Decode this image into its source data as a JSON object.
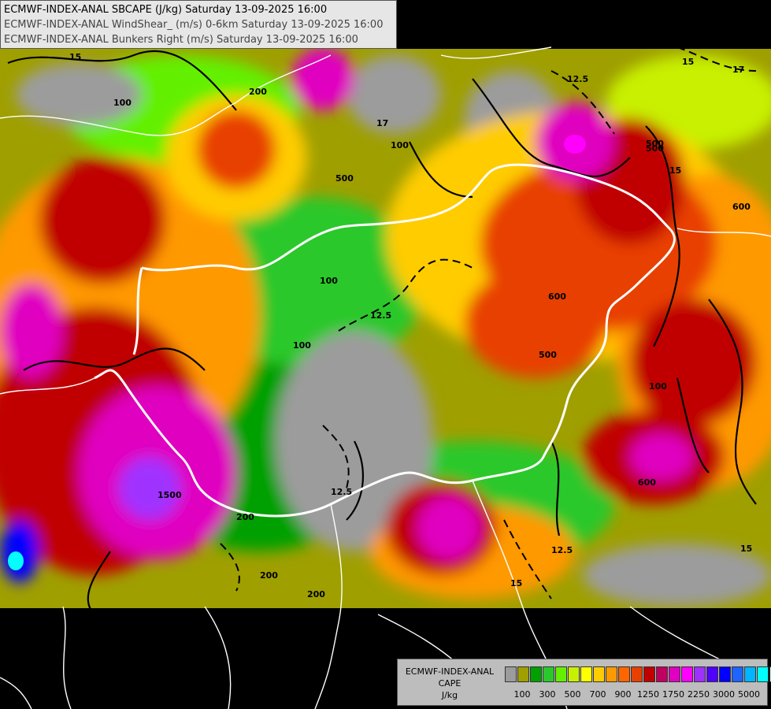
{
  "header": {
    "line1": "ECMWF-INDEX-ANAL SBCAPE (J/kg) Saturday 13-09-2025 16:00",
    "line2": "ECMWF-INDEX-ANAL WindShear_ (m/s) 0-6km Saturday 13-09-2025 16:00",
    "line3": "ECMWF-INDEX-ANAL Bunkers Right (m/s) Saturday 13-09-2025 16:00"
  },
  "legend": {
    "title_line1": "ECMWF-INDEX-ANAL",
    "title_line2": "CAPE",
    "title_line3": "J/kg",
    "swatch_colors": [
      "#9c9c9c",
      "#9f9f00",
      "#00a000",
      "#2bc82b",
      "#64f000",
      "#c8f000",
      "#ffff00",
      "#ffcc00",
      "#ff9900",
      "#ff6600",
      "#e84000",
      "#c00000",
      "#c00060",
      "#e000c0",
      "#ff00ff",
      "#a030ff",
      "#5000ff",
      "#0000ff",
      "#1e64ff",
      "#00b4ff",
      "#00ffff",
      "#b4ffff",
      "#ffffff"
    ],
    "tick_labels": [
      "100",
      "300",
      "500",
      "700",
      "900",
      "1250",
      "1750",
      "2250",
      "3000",
      "5000"
    ]
  },
  "contour_labels": [
    "15",
    "100",
    "17",
    "12.5",
    "15",
    "500",
    "17",
    "100",
    "15",
    "600",
    "200",
    "100",
    "12.5",
    "600",
    "500",
    "100",
    "200",
    "1500",
    "12.5",
    "200",
    "200",
    "15",
    "12.5",
    "15",
    "500",
    "600",
    "100",
    "500"
  ]
}
